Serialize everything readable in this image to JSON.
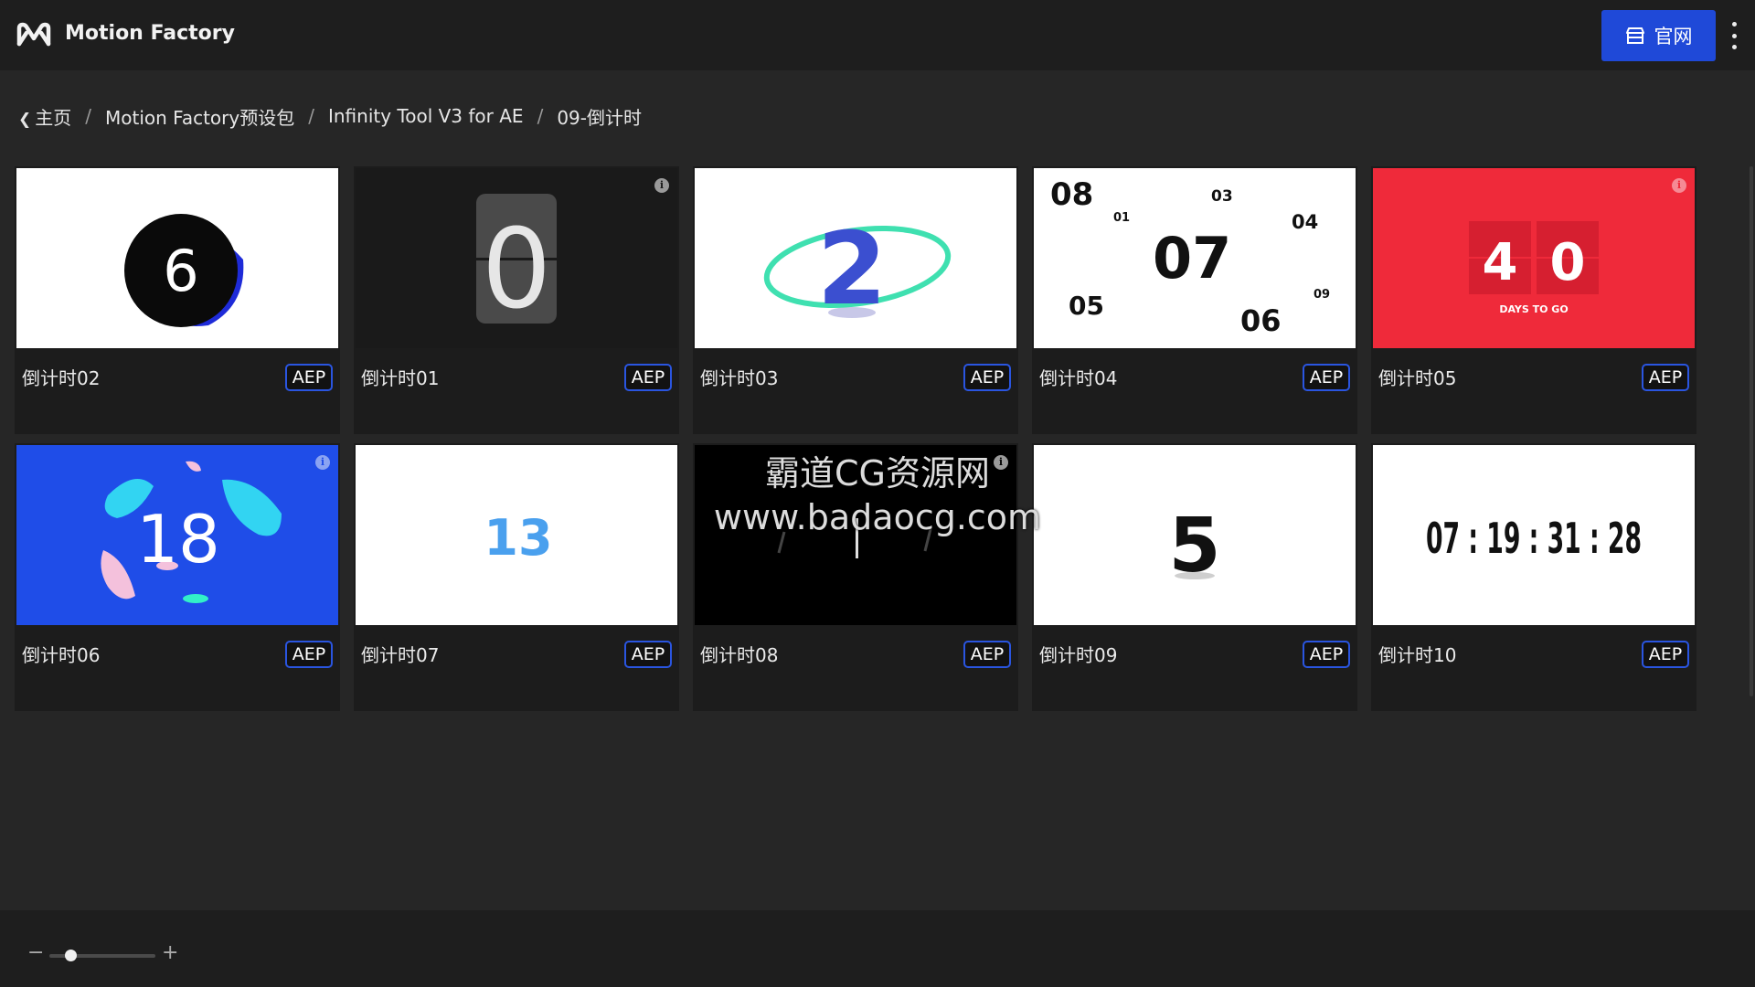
{
  "app": {
    "title": "Motion Factory"
  },
  "header": {
    "site_button_label": "官网",
    "icons": [
      "logo-icon",
      "store-icon",
      "more-vertical-icon"
    ]
  },
  "breadcrumb": {
    "items": [
      {
        "label": "主页",
        "icon": "chevron-left-icon"
      },
      {
        "label": "Motion Factory预设包"
      },
      {
        "label": "Infinity Tool V3 for AE"
      },
      {
        "label": "09-倒计时"
      }
    ],
    "separator": "/"
  },
  "cards": [
    {
      "title": "倒计时02",
      "badge": "AEP",
      "preview_text": "6"
    },
    {
      "title": "倒计时01",
      "badge": "AEP",
      "preview_text": "0"
    },
    {
      "title": "倒计时03",
      "badge": "AEP",
      "preview_text": "2"
    },
    {
      "title": "倒计时04",
      "badge": "AEP",
      "preview_text": [
        "08",
        "01",
        "03",
        "04",
        "07",
        "05",
        "06",
        "09"
      ]
    },
    {
      "title": "倒计时05",
      "badge": "AEP",
      "preview_text": [
        "4",
        "0",
        "DAYS TO GO"
      ]
    },
    {
      "title": "倒计时06",
      "badge": "AEP",
      "preview_text": "18"
    },
    {
      "title": "倒计时07",
      "badge": "AEP",
      "preview_text": "13"
    },
    {
      "title": "倒计时08",
      "badge": "AEP",
      "preview_text": ""
    },
    {
      "title": "倒计时09",
      "badge": "AEP",
      "preview_text": "5"
    },
    {
      "title": "倒计时10",
      "badge": "AEP",
      "preview_text": "07 : 19 : 31 : 28"
    }
  ],
  "watermark": {
    "line1": "霸道CG资源网",
    "line2": "www.badaocg.com"
  },
  "zoom": {
    "minus": "−",
    "plus": "+",
    "level": 0.2
  },
  "colors": {
    "accent": "#1f49d8",
    "badge_border": "#2a55e0",
    "background": "#262626",
    "topbar": "#1e1e1e"
  }
}
